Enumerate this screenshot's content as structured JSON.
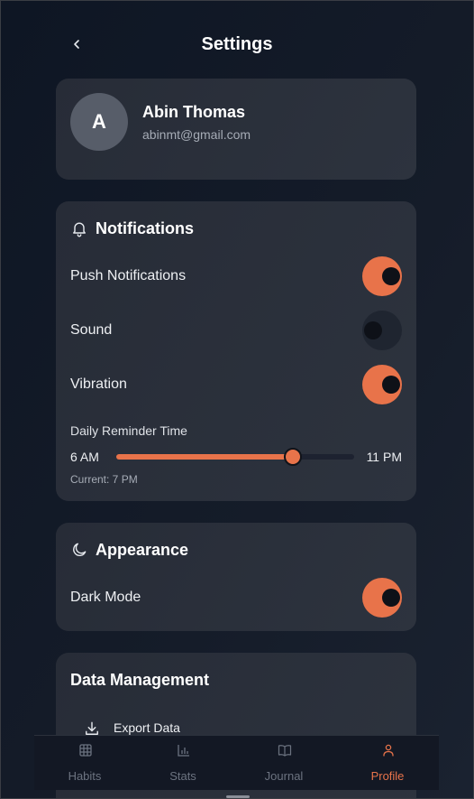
{
  "header": {
    "title": "Settings"
  },
  "profile": {
    "initial": "A",
    "name": "Abin Thomas",
    "email": "abinmt@gmail.com"
  },
  "notifications": {
    "title": "Notifications",
    "items": [
      {
        "label": "Push Notifications",
        "enabled": true
      },
      {
        "label": "Sound",
        "enabled": false
      },
      {
        "label": "Vibration",
        "enabled": true
      }
    ],
    "reminder": {
      "label": "Daily Reminder Time",
      "min_label": "6 AM",
      "max_label": "11 PM",
      "value_fraction": 0.74,
      "current_label": "Current: 7 PM"
    }
  },
  "appearance": {
    "title": "Appearance",
    "dark_mode_label": "Dark Mode",
    "dark_mode_enabled": true
  },
  "data_management": {
    "title": "Data Management",
    "export_label": "Export Data"
  },
  "tabs": [
    {
      "label": "Habits",
      "icon": "grid-icon"
    },
    {
      "label": "Stats",
      "icon": "bar-chart-icon"
    },
    {
      "label": "Journal",
      "icon": "book-icon"
    },
    {
      "label": "Profile",
      "icon": "user-icon",
      "active": true
    }
  ],
  "colors": {
    "accent": "#e8734a",
    "background": "#0d1420",
    "card": "#2a303b",
    "muted": "#6c7380"
  }
}
